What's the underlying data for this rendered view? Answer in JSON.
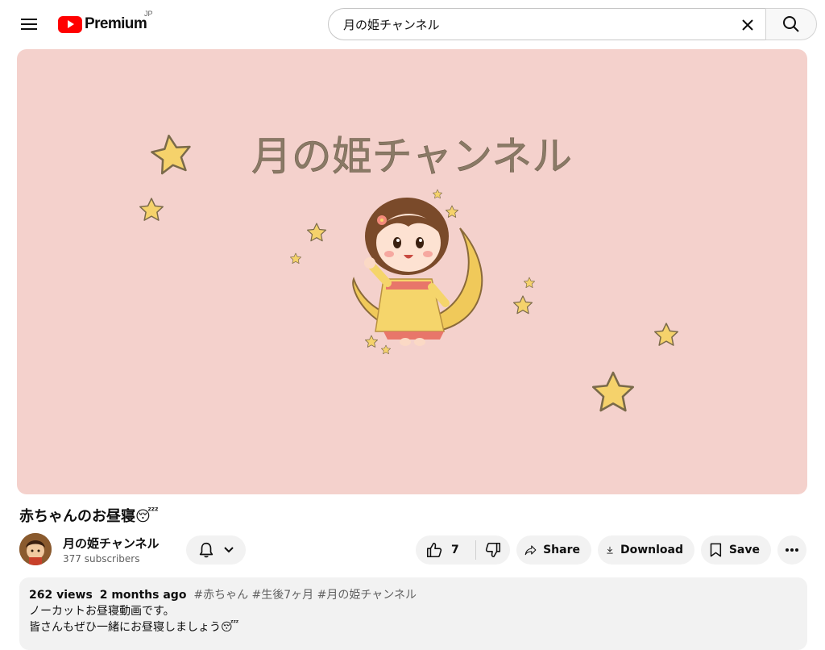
{
  "header": {
    "brand": "Premium",
    "region": "JP",
    "search_query": "月の姫チャンネル"
  },
  "player": {
    "thumbnail_title": "月の姫チャンネル",
    "background": "#f4d1cc",
    "star_color": "#f5d26b",
    "moon_color": "#f0c95a"
  },
  "video": {
    "title": "赤ちゃんのお昼寝😴",
    "channel_name": "月の姫チャンネル",
    "subscribers": "377 subscribers",
    "likes": "7",
    "share_label": "Share",
    "download_label": "Download",
    "save_label": "Save"
  },
  "description": {
    "views": "262 views",
    "age": "2 months ago",
    "tags": "#赤ちゃん #生後7ヶ月 #月の姫チャンネル",
    "line1": "ノーカットお昼寝動画です。",
    "line2": "皆さんもぜひ一緒にお昼寝しましょう😴"
  }
}
